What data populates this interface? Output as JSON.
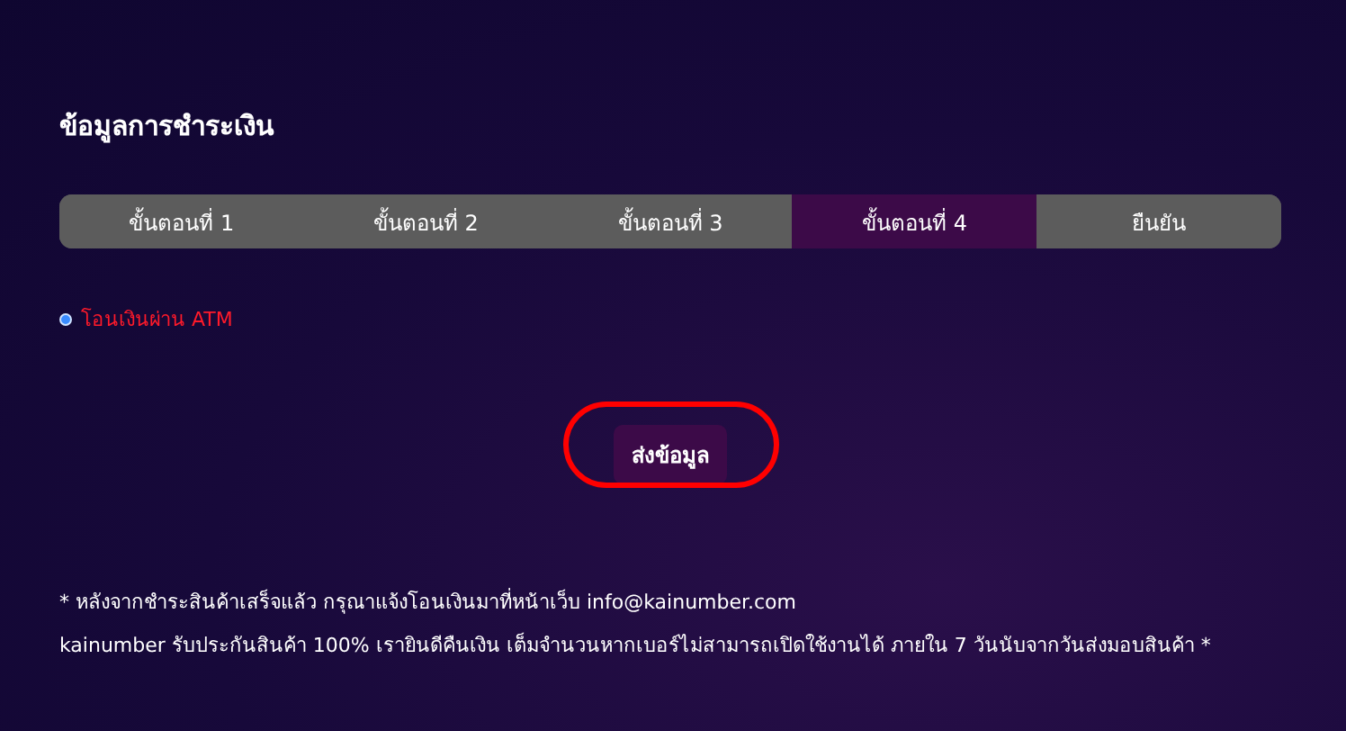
{
  "title": "ข้อมูลการชำระเงิน",
  "steps": [
    {
      "label": "ขั้นตอนที่ 1",
      "selected": false
    },
    {
      "label": "ขั้นตอนที่ 2",
      "selected": false
    },
    {
      "label": "ขั้นตอนที่ 3",
      "selected": false
    },
    {
      "label": "ขั้นตอนที่ 4",
      "selected": true
    },
    {
      "label": "ยืนยัน",
      "selected": false
    }
  ],
  "payment_options": [
    {
      "label": "โอนเงินผ่าน ATM",
      "selected": true
    }
  ],
  "submit_button": {
    "label": "ส่งข้อมูล",
    "highlighted": true
  },
  "notes": [
    "* หลังจากชำระสินค้าเสร็จแล้ว กรุณาแจ้งโอนเงินมาที่หน้าเว็บ info@kainumber.com",
    "kainumber รับประกันสินค้า 100% เรายินดีคืนเงิน เต็มจำนวนหากเบอร์ไม่สามารถเปิดใช้งานได้ ภายใน 7 วันนับจากวันส่งมอบสินค้า *"
  ]
}
